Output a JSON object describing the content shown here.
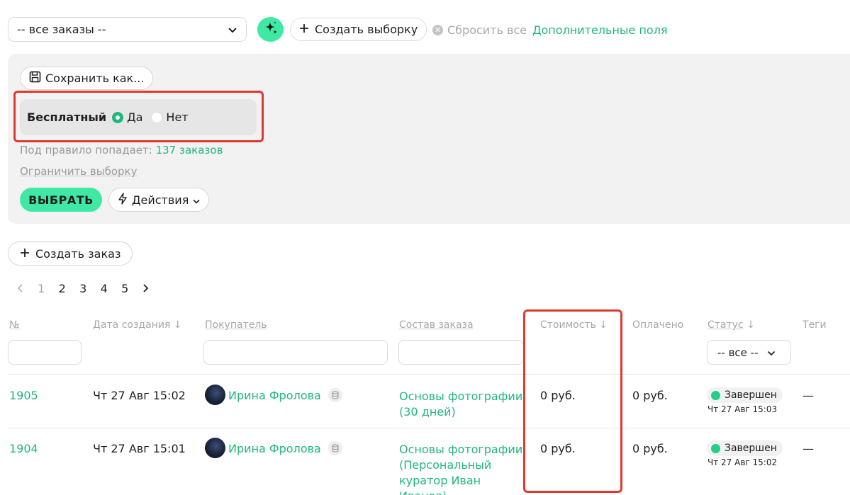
{
  "toolbar": {
    "orders_select": "-- все заказы --",
    "create_selection": "Создать выборку",
    "reset_all": "Сбросить все",
    "extra_fields": "Дополнительные поля"
  },
  "filter_panel": {
    "save_as": "Сохранить как...",
    "free_label": "Бесплатный",
    "option_yes": "Да",
    "option_no": "Нет",
    "selected_option": "Да",
    "rule_prefix": "Под правило попадает:",
    "rule_count": "137 заказов",
    "limit_selection": "Ограничить выборку",
    "choose_button": "ВЫБРАТЬ",
    "actions_button": "Действия"
  },
  "create_order": "Создать заказ",
  "pager": {
    "pages": [
      "1",
      "2",
      "3",
      "4",
      "5"
    ],
    "current": "1"
  },
  "table": {
    "headers": {
      "number": "№",
      "created": "Дата создания",
      "buyer": "Покупатель",
      "contents": "Состав заказа",
      "cost": "Стоимость",
      "paid": "Оплачено",
      "status": "Статус",
      "tags": "Теги"
    },
    "status_filter": "-- все --",
    "rows": [
      {
        "number": "1905",
        "created": "Чт 27 Авг 15:02",
        "buyer": "Ирина Фролова",
        "contents_line1": "Основы фотографии",
        "contents_line2": "(30 дней)",
        "contents_line3": "",
        "contents_line4": "",
        "cost": "0 руб.",
        "paid": "0 руб.",
        "status": "Завершен",
        "status_time": "Чт 27 Авг 15:03",
        "tags": "—"
      },
      {
        "number": "1904",
        "created": "Чт 27 Авг 15:01",
        "buyer": "Ирина Фролова",
        "contents_line1": "Основы фотографии",
        "contents_line2": "(Персональный",
        "contents_line3": "куратор Иван",
        "contents_line4": "Иванов)",
        "cost": "0 руб.",
        "paid": "0 руб.",
        "status": "Завершен",
        "status_time": "Чт 27 Авг 15:02",
        "tags": "—"
      }
    ]
  },
  "colors": {
    "accent": "#3fe8a5",
    "link": "#21b77c",
    "highlight": "#d83b30"
  }
}
